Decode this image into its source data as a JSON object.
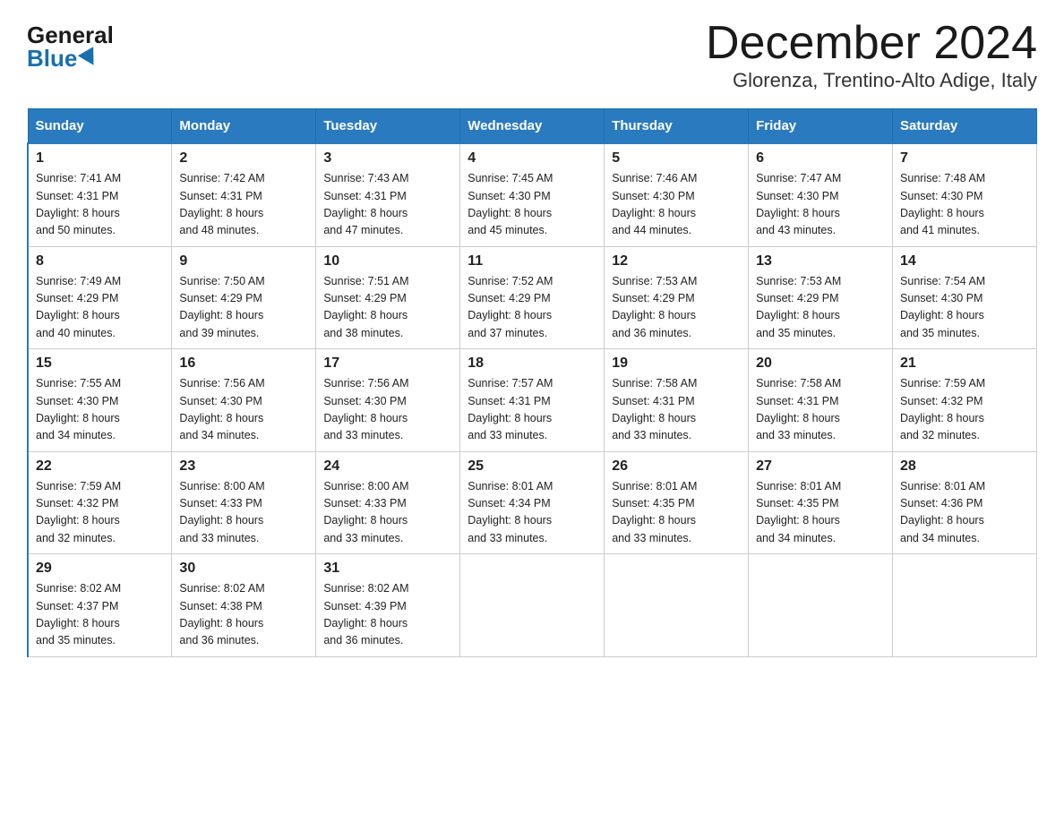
{
  "header": {
    "logo_general": "General",
    "logo_blue": "Blue",
    "title": "December 2024",
    "location": "Glorenza, Trentino-Alto Adige, Italy"
  },
  "days_of_week": [
    "Sunday",
    "Monday",
    "Tuesday",
    "Wednesday",
    "Thursday",
    "Friday",
    "Saturday"
  ],
  "weeks": [
    [
      {
        "day": "1",
        "sunrise": "7:41 AM",
        "sunset": "4:31 PM",
        "daylight": "8 hours and 50 minutes."
      },
      {
        "day": "2",
        "sunrise": "7:42 AM",
        "sunset": "4:31 PM",
        "daylight": "8 hours and 48 minutes."
      },
      {
        "day": "3",
        "sunrise": "7:43 AM",
        "sunset": "4:31 PM",
        "daylight": "8 hours and 47 minutes."
      },
      {
        "day": "4",
        "sunrise": "7:45 AM",
        "sunset": "4:30 PM",
        "daylight": "8 hours and 45 minutes."
      },
      {
        "day": "5",
        "sunrise": "7:46 AM",
        "sunset": "4:30 PM",
        "daylight": "8 hours and 44 minutes."
      },
      {
        "day": "6",
        "sunrise": "7:47 AM",
        "sunset": "4:30 PM",
        "daylight": "8 hours and 43 minutes."
      },
      {
        "day": "7",
        "sunrise": "7:48 AM",
        "sunset": "4:30 PM",
        "daylight": "8 hours and 41 minutes."
      }
    ],
    [
      {
        "day": "8",
        "sunrise": "7:49 AM",
        "sunset": "4:29 PM",
        "daylight": "8 hours and 40 minutes."
      },
      {
        "day": "9",
        "sunrise": "7:50 AM",
        "sunset": "4:29 PM",
        "daylight": "8 hours and 39 minutes."
      },
      {
        "day": "10",
        "sunrise": "7:51 AM",
        "sunset": "4:29 PM",
        "daylight": "8 hours and 38 minutes."
      },
      {
        "day": "11",
        "sunrise": "7:52 AM",
        "sunset": "4:29 PM",
        "daylight": "8 hours and 37 minutes."
      },
      {
        "day": "12",
        "sunrise": "7:53 AM",
        "sunset": "4:29 PM",
        "daylight": "8 hours and 36 minutes."
      },
      {
        "day": "13",
        "sunrise": "7:53 AM",
        "sunset": "4:29 PM",
        "daylight": "8 hours and 35 minutes."
      },
      {
        "day": "14",
        "sunrise": "7:54 AM",
        "sunset": "4:30 PM",
        "daylight": "8 hours and 35 minutes."
      }
    ],
    [
      {
        "day": "15",
        "sunrise": "7:55 AM",
        "sunset": "4:30 PM",
        "daylight": "8 hours and 34 minutes."
      },
      {
        "day": "16",
        "sunrise": "7:56 AM",
        "sunset": "4:30 PM",
        "daylight": "8 hours and 34 minutes."
      },
      {
        "day": "17",
        "sunrise": "7:56 AM",
        "sunset": "4:30 PM",
        "daylight": "8 hours and 33 minutes."
      },
      {
        "day": "18",
        "sunrise": "7:57 AM",
        "sunset": "4:31 PM",
        "daylight": "8 hours and 33 minutes."
      },
      {
        "day": "19",
        "sunrise": "7:58 AM",
        "sunset": "4:31 PM",
        "daylight": "8 hours and 33 minutes."
      },
      {
        "day": "20",
        "sunrise": "7:58 AM",
        "sunset": "4:31 PM",
        "daylight": "8 hours and 33 minutes."
      },
      {
        "day": "21",
        "sunrise": "7:59 AM",
        "sunset": "4:32 PM",
        "daylight": "8 hours and 32 minutes."
      }
    ],
    [
      {
        "day": "22",
        "sunrise": "7:59 AM",
        "sunset": "4:32 PM",
        "daylight": "8 hours and 32 minutes."
      },
      {
        "day": "23",
        "sunrise": "8:00 AM",
        "sunset": "4:33 PM",
        "daylight": "8 hours and 33 minutes."
      },
      {
        "day": "24",
        "sunrise": "8:00 AM",
        "sunset": "4:33 PM",
        "daylight": "8 hours and 33 minutes."
      },
      {
        "day": "25",
        "sunrise": "8:01 AM",
        "sunset": "4:34 PM",
        "daylight": "8 hours and 33 minutes."
      },
      {
        "day": "26",
        "sunrise": "8:01 AM",
        "sunset": "4:35 PM",
        "daylight": "8 hours and 33 minutes."
      },
      {
        "day": "27",
        "sunrise": "8:01 AM",
        "sunset": "4:35 PM",
        "daylight": "8 hours and 34 minutes."
      },
      {
        "day": "28",
        "sunrise": "8:01 AM",
        "sunset": "4:36 PM",
        "daylight": "8 hours and 34 minutes."
      }
    ],
    [
      {
        "day": "29",
        "sunrise": "8:02 AM",
        "sunset": "4:37 PM",
        "daylight": "8 hours and 35 minutes."
      },
      {
        "day": "30",
        "sunrise": "8:02 AM",
        "sunset": "4:38 PM",
        "daylight": "8 hours and 36 minutes."
      },
      {
        "day": "31",
        "sunrise": "8:02 AM",
        "sunset": "4:39 PM",
        "daylight": "8 hours and 36 minutes."
      },
      null,
      null,
      null,
      null
    ]
  ],
  "labels": {
    "sunrise": "Sunrise:",
    "sunset": "Sunset:",
    "daylight": "Daylight:"
  }
}
